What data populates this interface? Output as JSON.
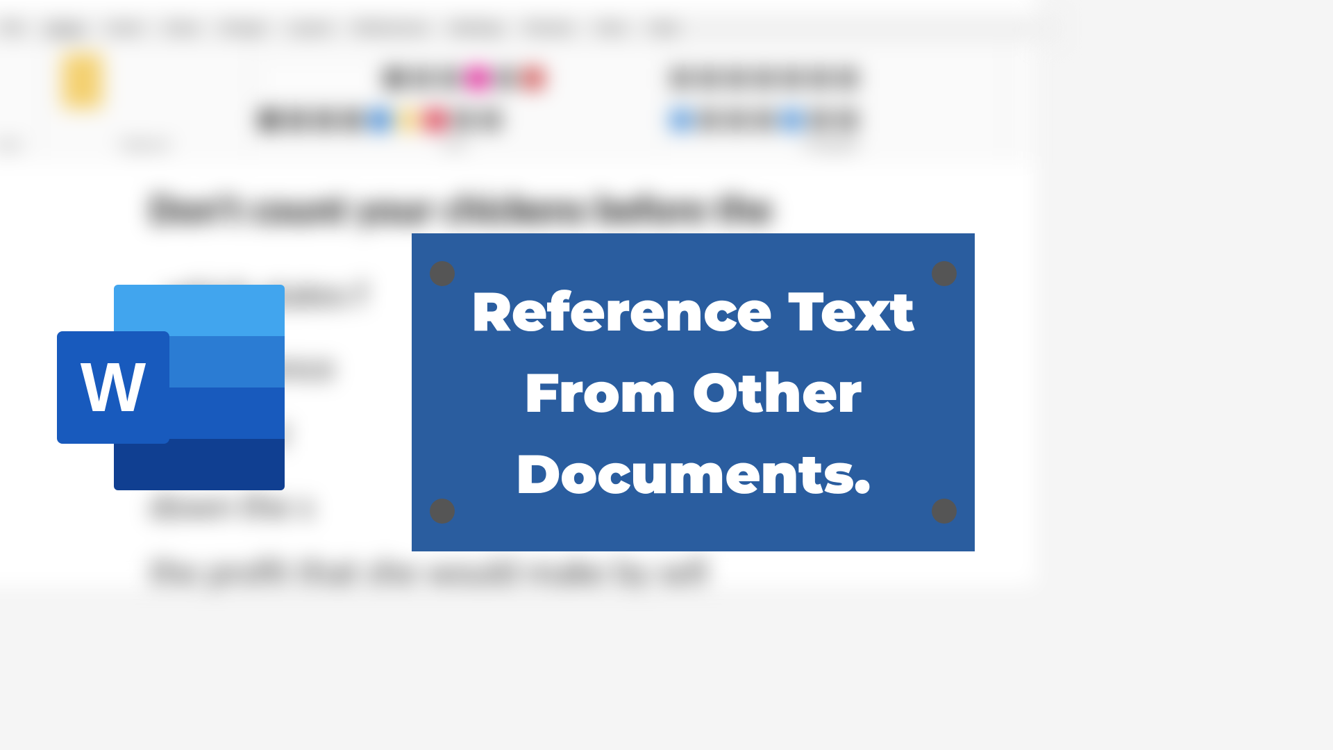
{
  "ribbon": {
    "tabs": [
      "File",
      "Home",
      "Insert",
      "Draw",
      "Design",
      "Layout",
      "References",
      "Mailings",
      "Review",
      "View",
      "Help"
    ],
    "groups": [
      "Undo",
      "Clipboard",
      "Font",
      "Paragraph"
    ]
  },
  "document": {
    "heading": "Don't count your chickens before the",
    "line2": "which states f",
    "line3": "reference",
    "line4": "ates f",
    "line5": "down the s",
    "line6": "the profit that she would make by sell"
  },
  "logo": {
    "letter": "W"
  },
  "card": {
    "title": "Reference Text From Other Documents."
  }
}
